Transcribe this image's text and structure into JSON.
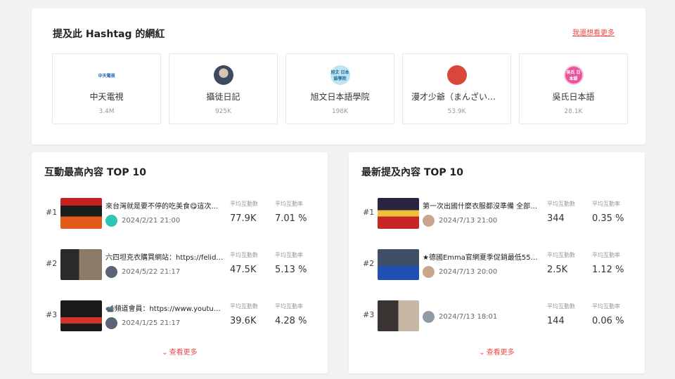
{
  "top": {
    "title": "提及此 Hashtag 的網紅",
    "more_link": "我還想看更多",
    "influencers": [
      {
        "name": "中天電視",
        "count": "3.4M",
        "icon": "ctitv-logo",
        "logo_text": "中天電視"
      },
      {
        "name": "攝徒日記",
        "count": "925K",
        "icon": "photo-avatar"
      },
      {
        "name": "旭文日本語學院",
        "count": "198K",
        "icon": "xuwen-logo",
        "logo_text": "旭文 日本語學院"
      },
      {
        "name": "漫才少爺（まんざいぼ…",
        "count": "53.9K",
        "icon": "manzai-avatar"
      },
      {
        "name": "吳氏日本語",
        "count": "28.1K",
        "icon": "wu-logo",
        "logo_text": "吳氏 日本語"
      }
    ]
  },
  "left": {
    "title": "互動最高內容 TOP 10",
    "see_more": "查看更多",
    "label_interactions": "平均互動數",
    "label_rate": "平均互動率",
    "posts": [
      {
        "rank": "#1",
        "title": "來台灣就是要不停的吃美食😋這次…",
        "date": "2024/2/21 21:00",
        "interactions": "77.9K",
        "rate": "7.01 %"
      },
      {
        "rank": "#2",
        "title": "六四坦克衣購買網站：https://felid…",
        "date": "2024/5/22 21:17",
        "interactions": "47.5K",
        "rate": "5.13 %"
      },
      {
        "rank": "#3",
        "title": "📹頻道會員：https://www.youtu…",
        "date": "2024/1/25 21:17",
        "interactions": "39.6K",
        "rate": "4.28 %"
      }
    ]
  },
  "right": {
    "title": "最新提及內容 TOP 10",
    "see_more": "查看更多",
    "label_interactions": "平均互動數",
    "label_rate": "平均互動率",
    "posts": [
      {
        "rank": "#1",
        "title": "第一次出國什麼衣服都沒準備 全部…",
        "date": "2024/7/13 21:00",
        "interactions": "344",
        "rate": "0.35 %"
      },
      {
        "rank": "#2",
        "title": "★德國Emma官網夏季促銷最低55…",
        "date": "2024/7/13 20:00",
        "interactions": "2.5K",
        "rate": "1.12 %"
      },
      {
        "rank": "#3",
        "title": "",
        "date": "2024/7/13 18:01",
        "interactions": "144",
        "rate": "0.06 %"
      }
    ]
  },
  "colors": {
    "accent": "#e94a4a",
    "background": "#f2f2f2",
    "card": "#ffffff"
  }
}
